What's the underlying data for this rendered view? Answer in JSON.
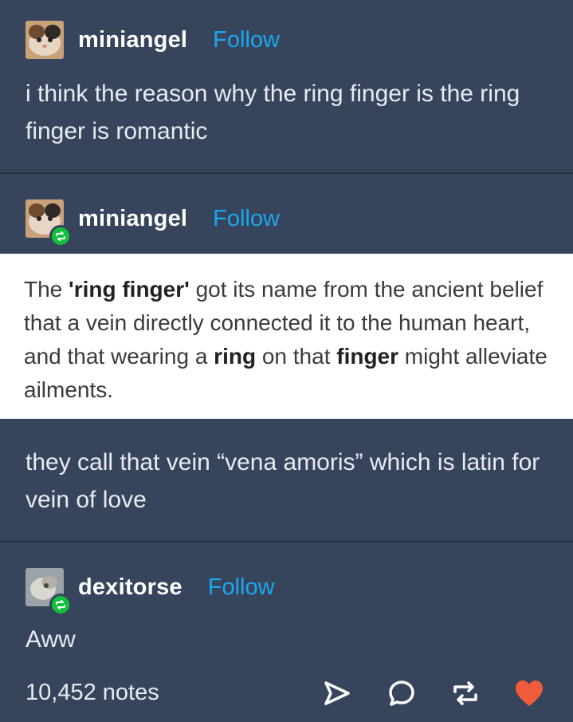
{
  "posts": [
    {
      "username": "miniangel",
      "follow": "Follow",
      "text": "i think the reason why the ring finger is the ring finger is romantic"
    },
    {
      "username": "miniangel",
      "follow": "Follow",
      "quote": {
        "parts": [
          {
            "t": "The ",
            "b": false
          },
          {
            "t": "'ring finger'",
            "b": true
          },
          {
            "t": " got its name from the ancient belief that a vein directly connected it to the human heart, and that wearing a ",
            "b": false
          },
          {
            "t": "ring",
            "b": true
          },
          {
            "t": " on that ",
            "b": false
          },
          {
            "t": "finger",
            "b": true
          },
          {
            "t": " might alleviate ailments.",
            "b": false
          }
        ]
      },
      "text": "they call that vein “vena amoris” which is latin for vein of love"
    },
    {
      "username": "dexitorse",
      "follow": "Follow",
      "text": "Aww"
    }
  ],
  "footer": {
    "notes": "10,452 notes"
  },
  "icons": [
    "share-icon",
    "reply-icon",
    "reblog-icon",
    "heart-icon",
    "reblog-badge-icon"
  ],
  "colors": {
    "background": "#37455c",
    "follow": "#1aa7f0",
    "reblog_badge": "#12c13a",
    "heart": "#f05c3a"
  }
}
